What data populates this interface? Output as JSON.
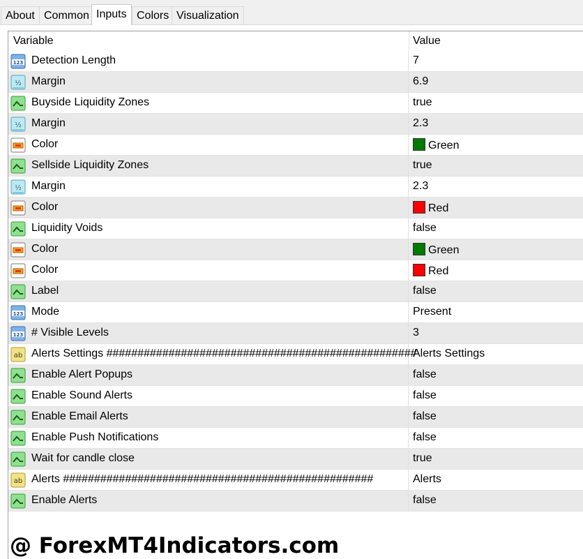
{
  "tabs": [
    {
      "label": "About",
      "active": false
    },
    {
      "label": "Common",
      "active": false
    },
    {
      "label": "Inputs",
      "active": true
    },
    {
      "label": "Colors",
      "active": false
    },
    {
      "label": "Visualization",
      "active": false
    }
  ],
  "table": {
    "headers": {
      "variable": "Variable",
      "value": "Value"
    },
    "rows": [
      {
        "type": "int",
        "icon": "int-123-icon",
        "name": "Detection Length",
        "value": "7"
      },
      {
        "type": "double",
        "icon": "double-icon",
        "name": "Margin",
        "value": "6.9"
      },
      {
        "type": "bool",
        "icon": "bool-icon",
        "name": "Buyside Liquidity Zones",
        "value": "true"
      },
      {
        "type": "double",
        "icon": "double-icon",
        "name": "Margin",
        "value": "2.3"
      },
      {
        "type": "color",
        "icon": "color-icon",
        "name": "Color",
        "value": "Green",
        "swatch": "#007a00"
      },
      {
        "type": "bool",
        "icon": "bool-icon",
        "name": "Sellside Liquidity Zones",
        "value": "true"
      },
      {
        "type": "double",
        "icon": "double-icon",
        "name": "Margin",
        "value": "2.3"
      },
      {
        "type": "color",
        "icon": "color-icon",
        "name": "Color",
        "value": "Red",
        "swatch": "#ff0000"
      },
      {
        "type": "bool",
        "icon": "bool-icon",
        "name": "Liquidity Voids",
        "value": "false"
      },
      {
        "type": "color",
        "icon": "color-icon",
        "name": "Color",
        "value": "Green",
        "swatch": "#007a00"
      },
      {
        "type": "color",
        "icon": "color-icon",
        "name": "Color",
        "value": "Red",
        "swatch": "#ff0000"
      },
      {
        "type": "bool",
        "icon": "bool-icon",
        "name": "Label",
        "value": "false"
      },
      {
        "type": "int",
        "icon": "int-123-icon",
        "name": "Mode",
        "value": "Present"
      },
      {
        "type": "int",
        "icon": "int-123-icon",
        "name": "# Visible Levels",
        "value": "3"
      },
      {
        "type": "string",
        "icon": "string-ab-icon",
        "name": "Alerts Settings ##################################################",
        "value": "Alerts Settings"
      },
      {
        "type": "bool",
        "icon": "bool-icon",
        "name": "Enable Alert Popups",
        "value": "false"
      },
      {
        "type": "bool",
        "icon": "bool-icon",
        "name": "Enable Sound Alerts",
        "value": "false"
      },
      {
        "type": "bool",
        "icon": "bool-icon",
        "name": "Enable Email Alerts",
        "value": "false"
      },
      {
        "type": "bool",
        "icon": "bool-icon",
        "name": "Enable Push Notifications",
        "value": "false"
      },
      {
        "type": "bool",
        "icon": "bool-icon",
        "name": "Wait for candle close",
        "value": "true"
      },
      {
        "type": "string",
        "icon": "string-ab-icon",
        "name": "Alerts ##################################################",
        "value": "Alerts"
      },
      {
        "type": "bool",
        "icon": "bool-icon",
        "name": "Enable Alerts",
        "value": "false"
      }
    ]
  },
  "watermark": "@ ForexMT4Indicators.com"
}
